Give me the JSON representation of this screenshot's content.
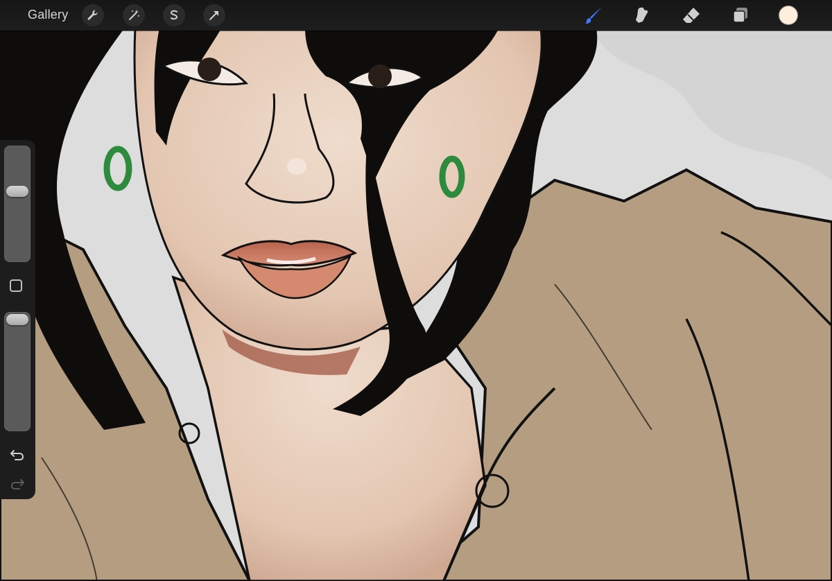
{
  "toolbar": {
    "gallery_label": "Gallery",
    "left_tools": [
      "wrench-icon",
      "magic-wand-icon",
      "selection-icon",
      "transform-arrow-icon"
    ],
    "right_tools": [
      "brush-icon",
      "smudge-icon",
      "eraser-icon",
      "layers-icon"
    ],
    "active_tool": "brush",
    "active_color": "#fdeede",
    "accent_color": "#3d7bff"
  },
  "sidebar": {
    "brush_size_level": 0.38,
    "opacity_level": 0.0,
    "controls": [
      "brush-size-slider",
      "modify-button",
      "opacity-slider",
      "undo-button",
      "redo-button"
    ]
  },
  "artwork": {
    "colors": {
      "background": "#dcdcdc",
      "coat": "#b39c7f",
      "skin": "#e6cdb9",
      "hair": "#0e0c0a",
      "lips": "#c97c65",
      "earring": "#2e8a3c",
      "line": "#111111"
    }
  }
}
